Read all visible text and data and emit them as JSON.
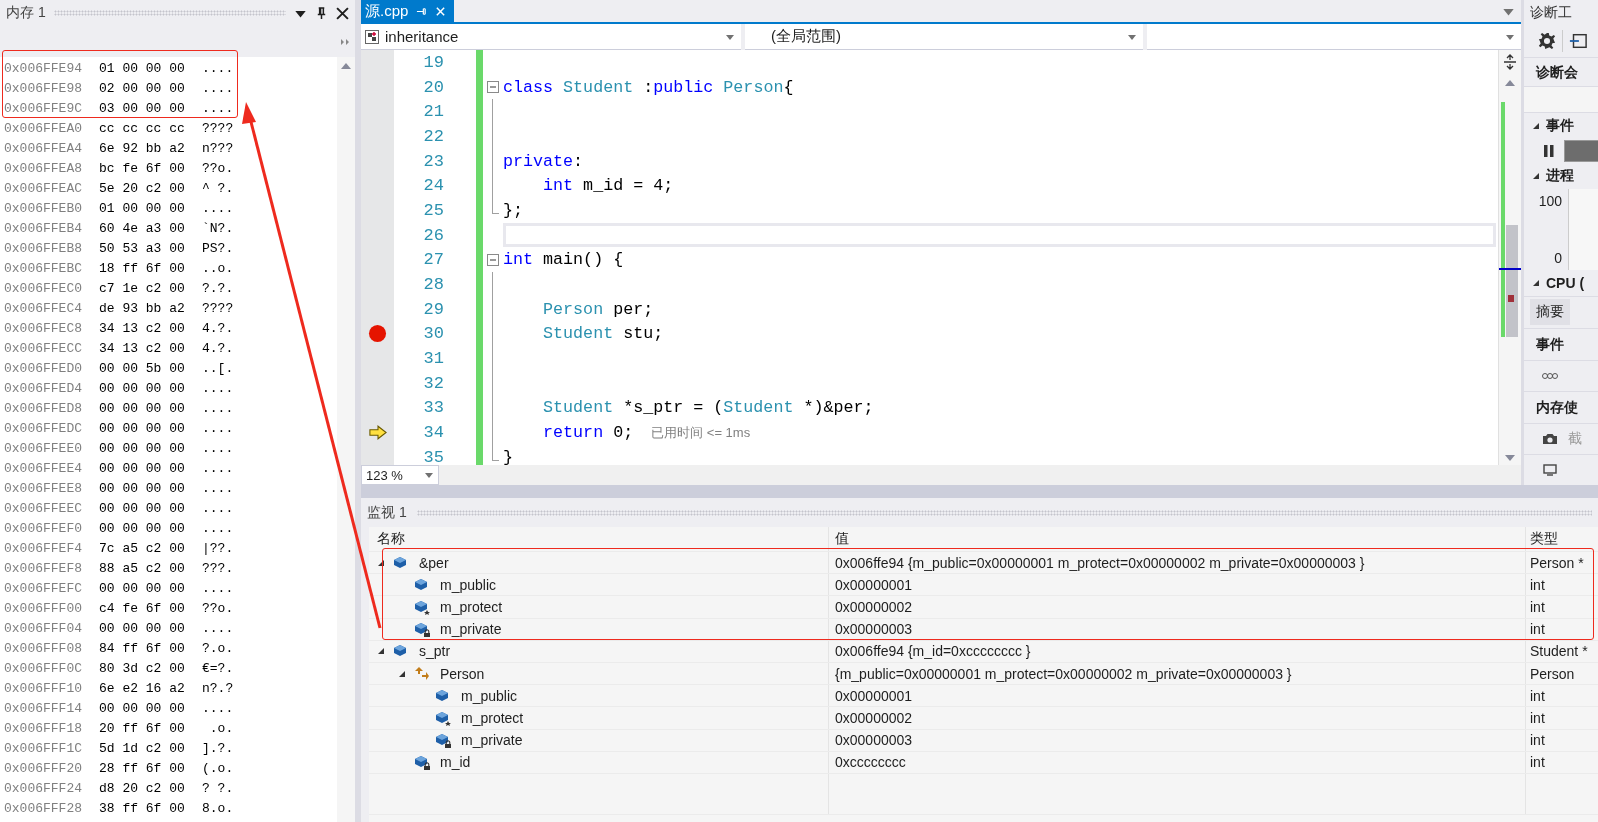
{
  "memory_panel": {
    "title": "内存 1",
    "rows": [
      {
        "address": "0x006FFE94",
        "bytes": "01 00 00 00",
        "ascii": "...."
      },
      {
        "address": "0x006FFE98",
        "bytes": "02 00 00 00",
        "ascii": "...."
      },
      {
        "address": "0x006FFE9C",
        "bytes": "03 00 00 00",
        "ascii": "...."
      },
      {
        "address": "0x006FFEA0",
        "bytes": "cc cc cc cc",
        "ascii": "????"
      },
      {
        "address": "0x006FFEA4",
        "bytes": "6e 92 bb a2",
        "ascii": "n???"
      },
      {
        "address": "0x006FFEA8",
        "bytes": "bc fe 6f 00",
        "ascii": "??o."
      },
      {
        "address": "0x006FFEAC",
        "bytes": "5e 20 c2 00",
        "ascii": "^ ?."
      },
      {
        "address": "0x006FFEB0",
        "bytes": "01 00 00 00",
        "ascii": "...."
      },
      {
        "address": "0x006FFEB4",
        "bytes": "60 4e a3 00",
        "ascii": "`N?."
      },
      {
        "address": "0x006FFEB8",
        "bytes": "50 53 a3 00",
        "ascii": "PS?."
      },
      {
        "address": "0x006FFEBC",
        "bytes": "18 ff 6f 00",
        "ascii": "..o."
      },
      {
        "address": "0x006FFEC0",
        "bytes": "c7 1e c2 00",
        "ascii": "?.?."
      },
      {
        "address": "0x006FFEC4",
        "bytes": "de 93 bb a2",
        "ascii": "????"
      },
      {
        "address": "0x006FFEC8",
        "bytes": "34 13 c2 00",
        "ascii": "4.?."
      },
      {
        "address": "0x006FFECC",
        "bytes": "34 13 c2 00",
        "ascii": "4.?."
      },
      {
        "address": "0x006FFED0",
        "bytes": "00 00 5b 00",
        "ascii": "..[."
      },
      {
        "address": "0x006FFED4",
        "bytes": "00 00 00 00",
        "ascii": "...."
      },
      {
        "address": "0x006FFED8",
        "bytes": "00 00 00 00",
        "ascii": "...."
      },
      {
        "address": "0x006FFEDC",
        "bytes": "00 00 00 00",
        "ascii": "...."
      },
      {
        "address": "0x006FFEE0",
        "bytes": "00 00 00 00",
        "ascii": "...."
      },
      {
        "address": "0x006FFEE4",
        "bytes": "00 00 00 00",
        "ascii": "...."
      },
      {
        "address": "0x006FFEE8",
        "bytes": "00 00 00 00",
        "ascii": "...."
      },
      {
        "address": "0x006FFEEC",
        "bytes": "00 00 00 00",
        "ascii": "...."
      },
      {
        "address": "0x006FFEF0",
        "bytes": "00 00 00 00",
        "ascii": "...."
      },
      {
        "address": "0x006FFEF4",
        "bytes": "7c a5 c2 00",
        "ascii": "|??."
      },
      {
        "address": "0x006FFEF8",
        "bytes": "88 a5 c2 00",
        "ascii": "???."
      },
      {
        "address": "0x006FFEFC",
        "bytes": "00 00 00 00",
        "ascii": "...."
      },
      {
        "address": "0x006FFF00",
        "bytes": "c4 fe 6f 00",
        "ascii": "??o."
      },
      {
        "address": "0x006FFF04",
        "bytes": "00 00 00 00",
        "ascii": "...."
      },
      {
        "address": "0x006FFF08",
        "bytes": "84 ff 6f 00",
        "ascii": "?.o."
      },
      {
        "address": "0x006FFF0C",
        "bytes": "80 3d c2 00",
        "ascii": "€=?."
      },
      {
        "address": "0x006FFF10",
        "bytes": "6e e2 16 a2",
        "ascii": "n?.?"
      },
      {
        "address": "0x006FFF14",
        "bytes": "00 00 00 00",
        "ascii": "...."
      },
      {
        "address": "0x006FFF18",
        "bytes": "20 ff 6f 00",
        "ascii": " .o."
      },
      {
        "address": "0x006FFF1C",
        "bytes": "5d 1d c2 00",
        "ascii": "].?."
      },
      {
        "address": "0x006FFF20",
        "bytes": "28 ff 6f 00",
        "ascii": "(.o."
      },
      {
        "address": "0x006FFF24",
        "bytes": "d8 20 c2 00",
        "ascii": "? ?."
      },
      {
        "address": "0x006FFF28",
        "bytes": "38 ff 6f 00",
        "ascii": "8.o."
      }
    ]
  },
  "editor": {
    "tab": {
      "label": "源.cpp",
      "selected": true
    },
    "project_dropdown": "inheritance",
    "scope_dropdown": "(全局范围)",
    "zoom": "123 %",
    "lines": [
      {
        "number": "19",
        "kind": "plain",
        "breakpoint": false,
        "current": false,
        "highlighted": false
      },
      {
        "number": "20",
        "kind": "block_start",
        "breakpoint": false,
        "current": false,
        "highlighted": false,
        "tokens": [
          {
            "text": "class ",
            "kind": "keyword"
          },
          {
            "text": "Student",
            "kind": "type"
          },
          {
            "text": " :",
            "kind": "plain"
          },
          {
            "text": "public ",
            "kind": "keyword"
          },
          {
            "text": "Person",
            "kind": "type"
          },
          {
            "text": "{",
            "kind": "plain"
          }
        ]
      },
      {
        "number": "21",
        "kind": "block_body",
        "breakpoint": false,
        "current": false,
        "highlighted": false
      },
      {
        "number": "22",
        "kind": "block_body",
        "breakpoint": false,
        "current": false,
        "highlighted": false
      },
      {
        "number": "23",
        "kind": "block_body",
        "breakpoint": false,
        "current": false,
        "highlighted": false,
        "tokens": [
          {
            "text": "private",
            "kind": "keyword"
          },
          {
            "text": ":",
            "kind": "plain"
          }
        ]
      },
      {
        "number": "24",
        "kind": "block_body",
        "breakpoint": false,
        "current": false,
        "highlighted": false,
        "tokens": [
          {
            "text": "    int",
            "kind": "keyword"
          },
          {
            "text": " m_id = 4;",
            "kind": "plain"
          }
        ]
      },
      {
        "number": "25",
        "kind": "block_end",
        "breakpoint": false,
        "current": false,
        "highlighted": false,
        "tokens": [
          {
            "text": "};",
            "kind": "plain"
          }
        ]
      },
      {
        "number": "26",
        "kind": "plain",
        "breakpoint": false,
        "current": false,
        "highlighted": true
      },
      {
        "number": "27",
        "kind": "block_start",
        "breakpoint": false,
        "current": false,
        "highlighted": false,
        "tokens": [
          {
            "text": "int",
            "kind": "keyword"
          },
          {
            "text": " main() {",
            "kind": "plain"
          }
        ]
      },
      {
        "number": "28",
        "kind": "block_body",
        "breakpoint": false,
        "current": false,
        "highlighted": false
      },
      {
        "number": "29",
        "kind": "block_body",
        "breakpoint": false,
        "current": false,
        "highlighted": false,
        "tokens": [
          {
            "text": "    Person",
            "kind": "type"
          },
          {
            "text": " per;",
            "kind": "plain"
          }
        ]
      },
      {
        "number": "30",
        "kind": "block_body",
        "breakpoint": true,
        "current": false,
        "highlighted": false,
        "tokens": [
          {
            "text": "    Student",
            "kind": "type"
          },
          {
            "text": " stu;",
            "kind": "plain"
          }
        ]
      },
      {
        "number": "31",
        "kind": "block_body",
        "breakpoint": false,
        "current": false,
        "highlighted": false
      },
      {
        "number": "32",
        "kind": "block_body",
        "breakpoint": false,
        "current": false,
        "highlighted": false
      },
      {
        "number": "33",
        "kind": "block_body",
        "breakpoint": false,
        "current": false,
        "highlighted": false,
        "tokens": [
          {
            "text": "    Student",
            "kind": "type"
          },
          {
            "text": " *s_ptr = (",
            "kind": "plain"
          },
          {
            "text": "Student",
            "kind": "type"
          },
          {
            "text": " *)&per;",
            "kind": "plain"
          }
        ]
      },
      {
        "number": "34",
        "kind": "block_body",
        "breakpoint": false,
        "current": true,
        "highlighted": false,
        "tokens": [
          {
            "text": "    return",
            "kind": "keyword"
          },
          {
            "text": " 0;",
            "kind": "plain"
          }
        ],
        "hint": "已用时间 <= 1ms"
      },
      {
        "number": "35",
        "kind": "block_end",
        "breakpoint": false,
        "current": false,
        "highlighted": false,
        "tokens": [
          {
            "text": "}",
            "kind": "plain"
          }
        ]
      }
    ]
  },
  "diagnostics": {
    "title": "诊断工",
    "session_heading": "诊断会",
    "events_section": "事件",
    "process_section": "进程",
    "axis_max": "100",
    "axis_min": "0",
    "cpu_section": "CPU (",
    "tabs": [
      {
        "label": "摘要",
        "selected": true
      }
    ],
    "events_heading": "事件",
    "memory_heading": "内存使",
    "snapshot_entry": "截"
  },
  "watch": {
    "title": "监视 1",
    "columns": [
      "名称",
      "值",
      "类型"
    ],
    "items": [
      {
        "name": "&per",
        "value": "0x006ffe94 {m_public=0x00000001 m_protect=0x00000002 m_private=0x00000003 }",
        "type": "Person *",
        "kind": "field",
        "expanded": true,
        "children": [
          {
            "name": "m_public",
            "value": "0x00000001",
            "type": "int",
            "kind": "field"
          },
          {
            "name": "m_protect",
            "value": "0x00000002",
            "type": "int",
            "kind": "protected"
          },
          {
            "name": "m_private",
            "value": "0x00000003",
            "type": "int",
            "kind": "private"
          }
        ]
      },
      {
        "name": "s_ptr",
        "value": "0x006ffe94 {m_id=0xcccccccc }",
        "type": "Student *",
        "kind": "field",
        "expanded": true,
        "children": [
          {
            "name": "Person",
            "value": "{m_public=0x00000001 m_protect=0x00000002 m_private=0x00000003 }",
            "type": "Person",
            "kind": "base",
            "expanded": true,
            "children": [
              {
                "name": "m_public",
                "value": "0x00000001",
                "type": "int",
                "kind": "field"
              },
              {
                "name": "m_protect",
                "value": "0x00000002",
                "type": "int",
                "kind": "protected"
              },
              {
                "name": "m_private",
                "value": "0x00000003",
                "type": "int",
                "kind": "private"
              }
            ]
          },
          {
            "name": "m_id",
            "value": "0xcccccccc",
            "type": "int",
            "kind": "private"
          }
        ]
      }
    ]
  }
}
